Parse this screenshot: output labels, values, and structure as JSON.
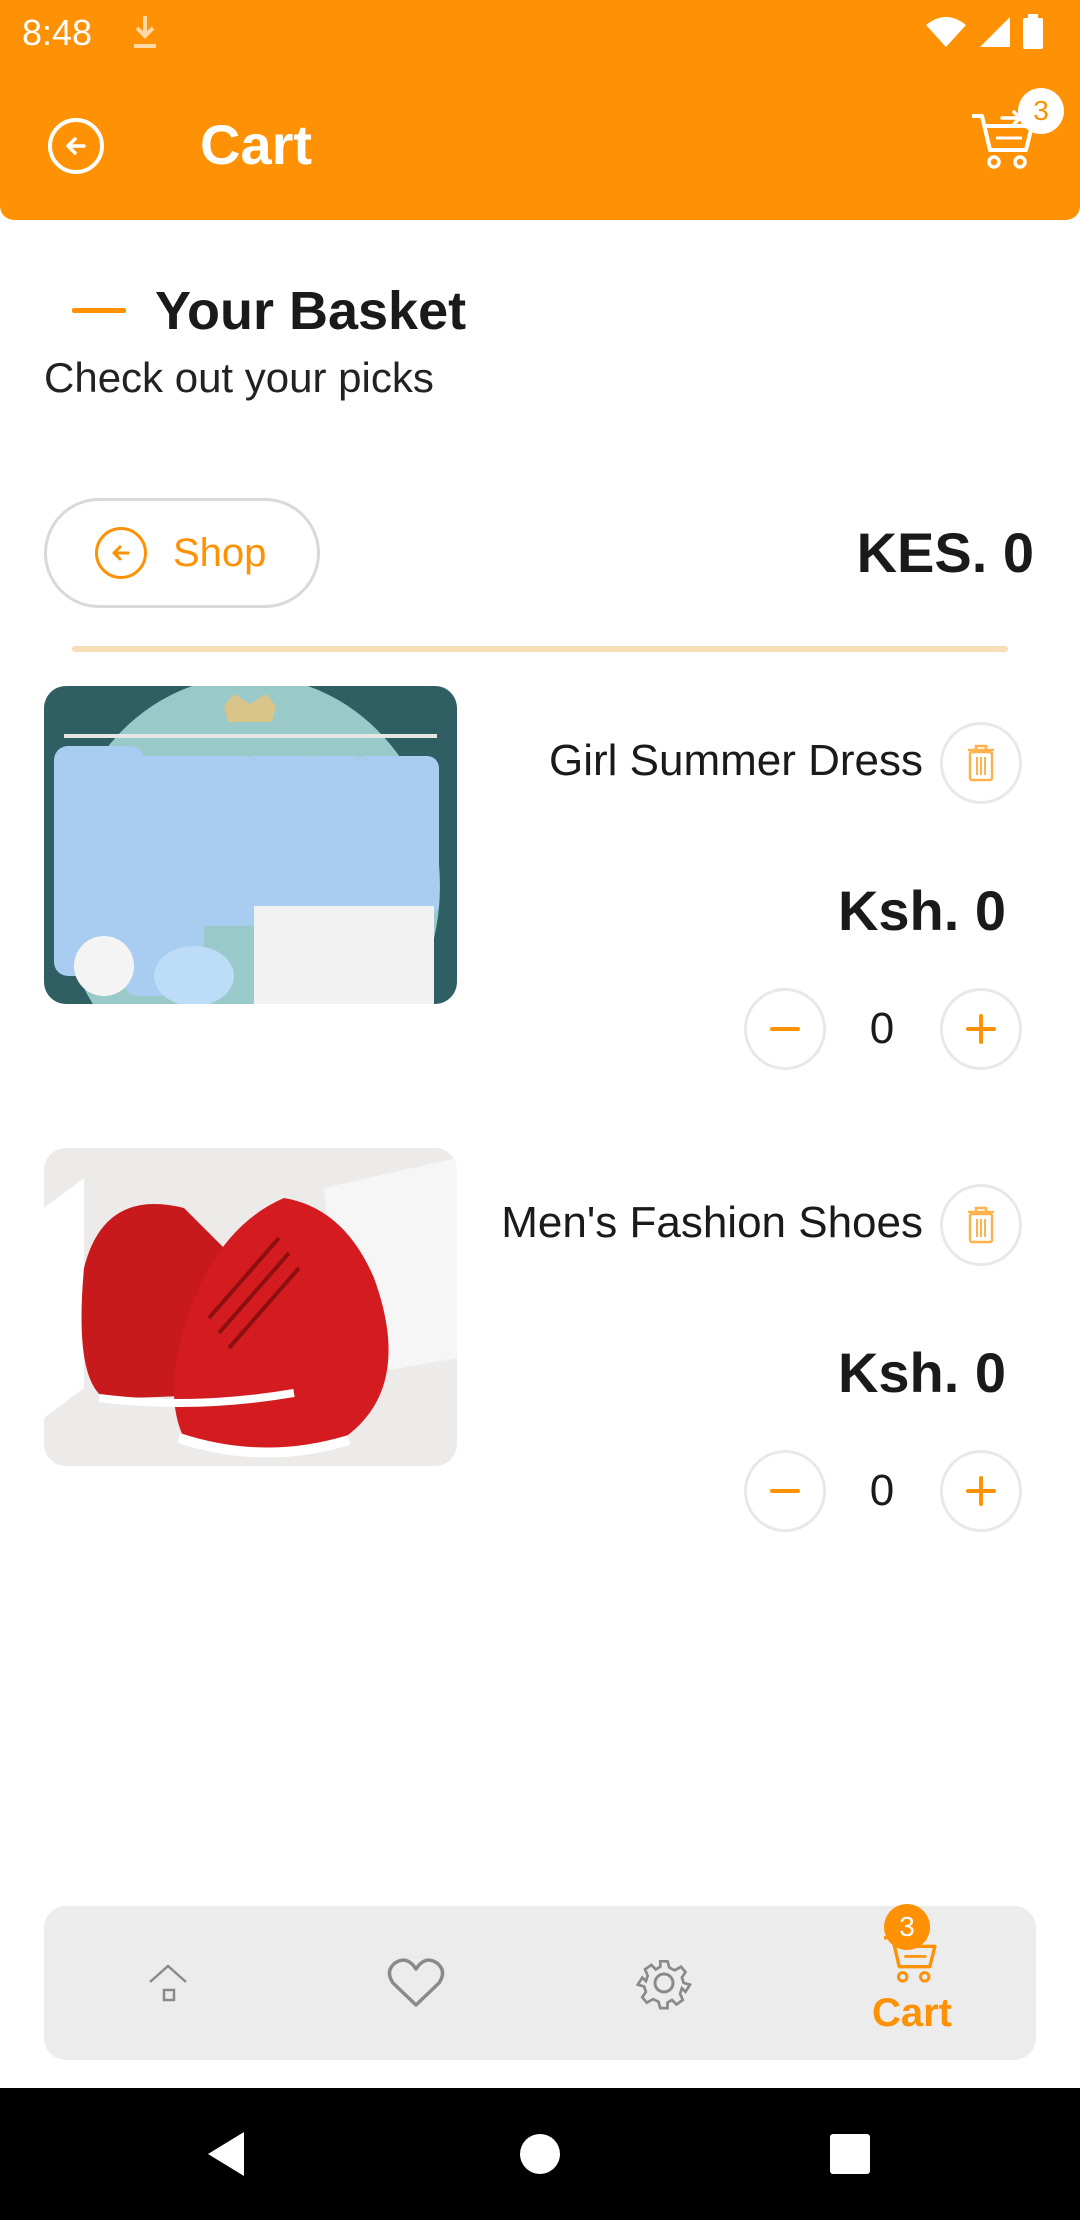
{
  "status_bar": {
    "time": "8:48"
  },
  "header": {
    "title": "Cart",
    "cart_badge": "3"
  },
  "basket": {
    "title": "Your Basket",
    "subtitle": "Check out your picks"
  },
  "shop_button": {
    "label": "Shop"
  },
  "total": "KES. 0",
  "items": [
    {
      "name": "Girl Summer Dress",
      "price": "Ksh. 0",
      "quantity": "0"
    },
    {
      "name": "Men's Fashion Shoes",
      "price": "Ksh. 0",
      "quantity": "0"
    }
  ],
  "bottom_nav": {
    "cart_label": "Cart",
    "cart_badge": "3"
  },
  "colors": {
    "accent": "#ff9105",
    "divider": "#f6deb6",
    "nav_bg": "#ececec"
  }
}
